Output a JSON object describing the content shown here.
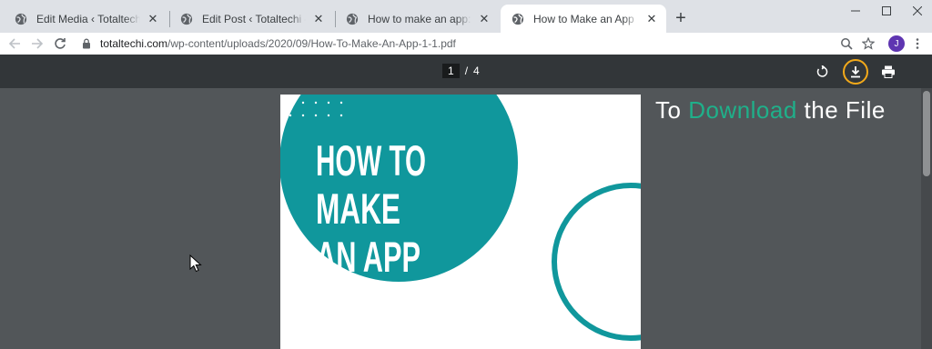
{
  "browser": {
    "tabs": [
      {
        "title": "Edit Media ‹ Totaltechi — WordPress",
        "active": false
      },
      {
        "title": "Edit Post ‹ Totaltechi — WordPress",
        "active": false
      },
      {
        "title": "How to make an app: Lessons Learned",
        "active": false
      },
      {
        "title": "How to Make an App",
        "active": true
      }
    ],
    "url_host": "totaltechi.com",
    "url_path": "/wp-content/uploads/2020/09/How-To-Make-An-App-1-1.pdf",
    "avatar_initial": "J"
  },
  "pdf": {
    "current_page": "1",
    "separator": "/",
    "total_pages": "4"
  },
  "document": {
    "title_line1": "HOW TO",
    "title_line2": "MAKE",
    "title_line3": "AN APP",
    "teal_color": "#10979c"
  },
  "overlay": {
    "prefix": "To ",
    "accent": "Download",
    "suffix": " the File",
    "accent_color": "#1fb08a",
    "highlight_color": "#f2a91a"
  }
}
